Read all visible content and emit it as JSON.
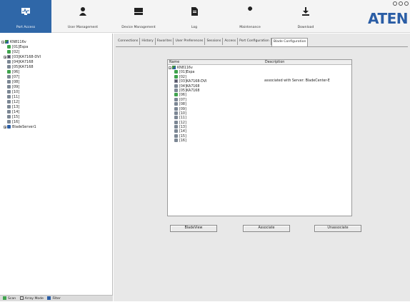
{
  "window": {
    "brand": "ATEN"
  },
  "toolbar": {
    "items": [
      {
        "label": "Port Access",
        "icon": "monitor-icon"
      },
      {
        "label": "User Management",
        "icon": "user-icon"
      },
      {
        "label": "Device Management",
        "icon": "device-icon"
      },
      {
        "label": "Log",
        "icon": "log-icon"
      },
      {
        "label": "Maintenance",
        "icon": "wrench-icon"
      },
      {
        "label": "Download",
        "icon": "download-icon"
      }
    ],
    "active_color": "#2f67a8"
  },
  "left_tree": {
    "root": "KN8116v",
    "items": [
      "[01]Espa",
      "[02]",
      "[03]KA7168-DVI",
      "[04]KA7168",
      "[05]KA7168",
      "[06]",
      "[07]",
      "[08]",
      "[09]",
      "[10]",
      "[11]",
      "[12]",
      "[13]",
      "[14]",
      "[15]",
      "[16]"
    ],
    "blade_server": "BladeServer1"
  },
  "statusbar": {
    "scan": "Scan",
    "array_mode": "Array Mode",
    "filter": "Filter"
  },
  "tabs": [
    {
      "label": "Connections"
    },
    {
      "label": "History"
    },
    {
      "label": "Favorites"
    },
    {
      "label": "User Preferences"
    },
    {
      "label": "Sessions"
    },
    {
      "label": "Access"
    },
    {
      "label": "Port Configuration"
    },
    {
      "label": "Blade Configuration"
    }
  ],
  "blade_panel": {
    "header_name": "Name",
    "header_description": "Description",
    "root": "KN8116v",
    "items": [
      {
        "name": "[01]Espa",
        "description": ""
      },
      {
        "name": "[02]",
        "description": ""
      },
      {
        "name": "[03]KA7168-DVI",
        "description": "associated with Server: BladeCenter-E"
      },
      {
        "name": "[04]KA7168",
        "description": ""
      },
      {
        "name": "[05]KA7168",
        "description": ""
      },
      {
        "name": "[06]",
        "description": ""
      },
      {
        "name": "[07]",
        "description": ""
      },
      {
        "name": "[08]",
        "description": ""
      },
      {
        "name": "[09]",
        "description": ""
      },
      {
        "name": "[10]",
        "description": ""
      },
      {
        "name": "[11]",
        "description": ""
      },
      {
        "name": "[12]",
        "description": ""
      },
      {
        "name": "[13]",
        "description": ""
      },
      {
        "name": "[14]",
        "description": ""
      },
      {
        "name": "[15]",
        "description": ""
      },
      {
        "name": "[16]",
        "description": ""
      }
    ]
  },
  "buttons": {
    "blade_view": "BladeView",
    "associate": "Associate",
    "unassociate": "Unassociate"
  }
}
